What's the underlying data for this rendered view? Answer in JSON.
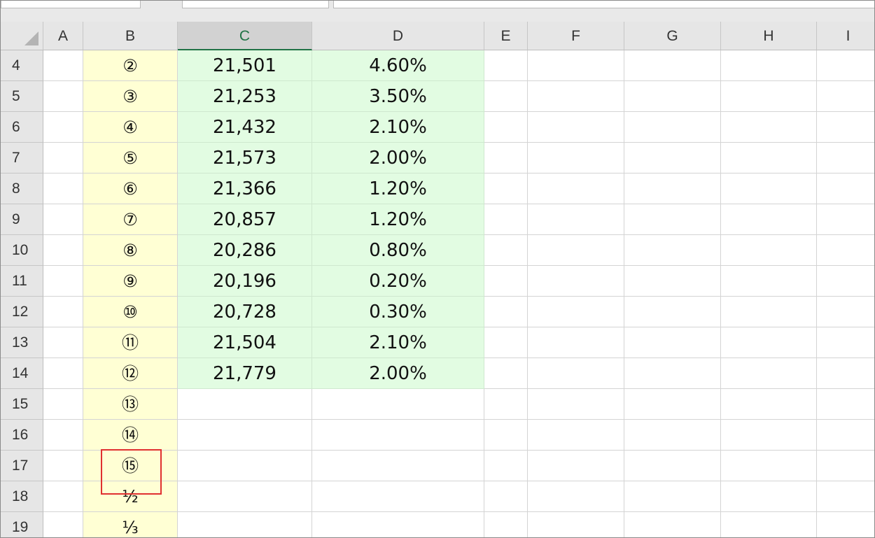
{
  "columns": [
    "A",
    "B",
    "C",
    "D",
    "E",
    "F",
    "G",
    "H",
    "I"
  ],
  "selected_column": "C",
  "rows": [
    {
      "row": "4",
      "b": "②",
      "c": "21,501",
      "d": "4.60%"
    },
    {
      "row": "5",
      "b": "③",
      "c": "21,253",
      "d": "3.50%"
    },
    {
      "row": "6",
      "b": "④",
      "c": "21,432",
      "d": "2.10%"
    },
    {
      "row": "7",
      "b": "⑤",
      "c": "21,573",
      "d": "2.00%"
    },
    {
      "row": "8",
      "b": "⑥",
      "c": "21,366",
      "d": "1.20%"
    },
    {
      "row": "9",
      "b": "⑦",
      "c": "20,857",
      "d": "1.20%"
    },
    {
      "row": "10",
      "b": "⑧",
      "c": "20,286",
      "d": "0.80%"
    },
    {
      "row": "11",
      "b": "⑨",
      "c": "20,196",
      "d": "0.20%"
    },
    {
      "row": "12",
      "b": "⑩",
      "c": "20,728",
      "d": "0.30%"
    },
    {
      "row": "13",
      "b": "⑪",
      "c": "21,504",
      "d": "2.10%"
    },
    {
      "row": "14",
      "b": "⑫",
      "c": "21,779",
      "d": "2.00%"
    },
    {
      "row": "15",
      "b": "⑬",
      "c": "",
      "d": ""
    },
    {
      "row": "16",
      "b": "⑭",
      "c": "",
      "d": ""
    },
    {
      "row": "17",
      "b": "⑮",
      "c": "",
      "d": ""
    },
    {
      "row": "18",
      "b": "½",
      "c": "",
      "d": ""
    },
    {
      "row": "19",
      "b": "⅓",
      "c": "",
      "d": ""
    }
  ],
  "colors": {
    "column_b_fill": "#ffffd4",
    "data_fill": "#e2fce2",
    "selected_header_accent": "#217346",
    "highlight_box": "#e03030"
  }
}
